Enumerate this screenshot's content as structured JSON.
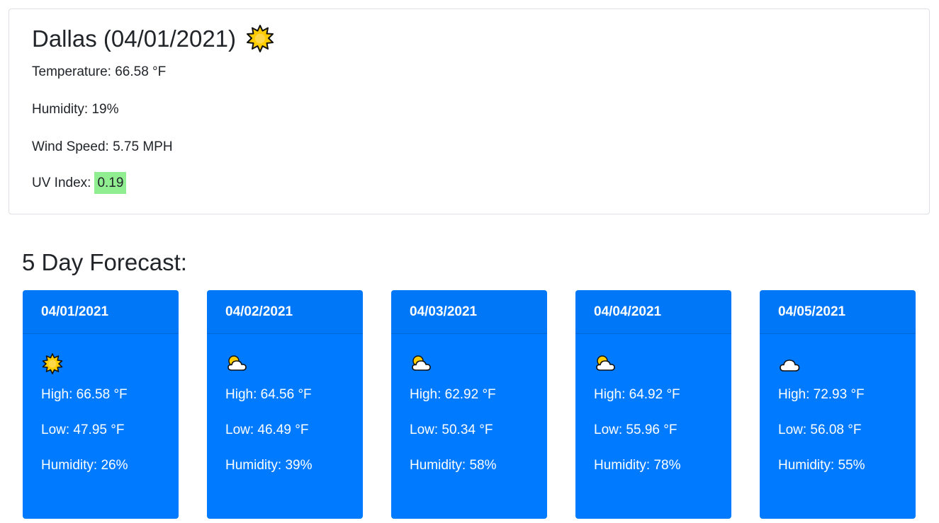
{
  "current": {
    "title": "Dallas (04/01/2021)",
    "icon": "sun-icon",
    "temperature": "Temperature: 66.58 °F",
    "humidity": "Humidity: 19%",
    "wind": "Wind Speed: 5.75 MPH",
    "uv_label": "UV Index:",
    "uv_value": "0.19",
    "uv_color": "#90ee90"
  },
  "forecast": {
    "heading": "5 Day Forecast:",
    "card_color": "#007bff",
    "days": [
      {
        "date": "04/01/2021",
        "icon": "sun-icon",
        "high": "High: 66.58 °F",
        "low": "Low: 47.95 °F",
        "humidity": "Humidity: 26%"
      },
      {
        "date": "04/02/2021",
        "icon": "partly-cloudy-icon",
        "high": "High: 64.56 °F",
        "low": "Low: 46.49 °F",
        "humidity": "Humidity: 39%"
      },
      {
        "date": "04/03/2021",
        "icon": "partly-cloudy-icon",
        "high": "High: 62.92 °F",
        "low": "Low: 50.34 °F",
        "humidity": "Humidity: 58%"
      },
      {
        "date": "04/04/2021",
        "icon": "partly-cloudy-icon",
        "high": "High: 64.92 °F",
        "low": "Low: 55.96 °F",
        "humidity": "Humidity: 78%"
      },
      {
        "date": "04/05/2021",
        "icon": "cloud-icon",
        "high": "High: 72.93 °F",
        "low": "Low: 56.08 °F",
        "humidity": "Humidity: 55%"
      }
    ]
  }
}
